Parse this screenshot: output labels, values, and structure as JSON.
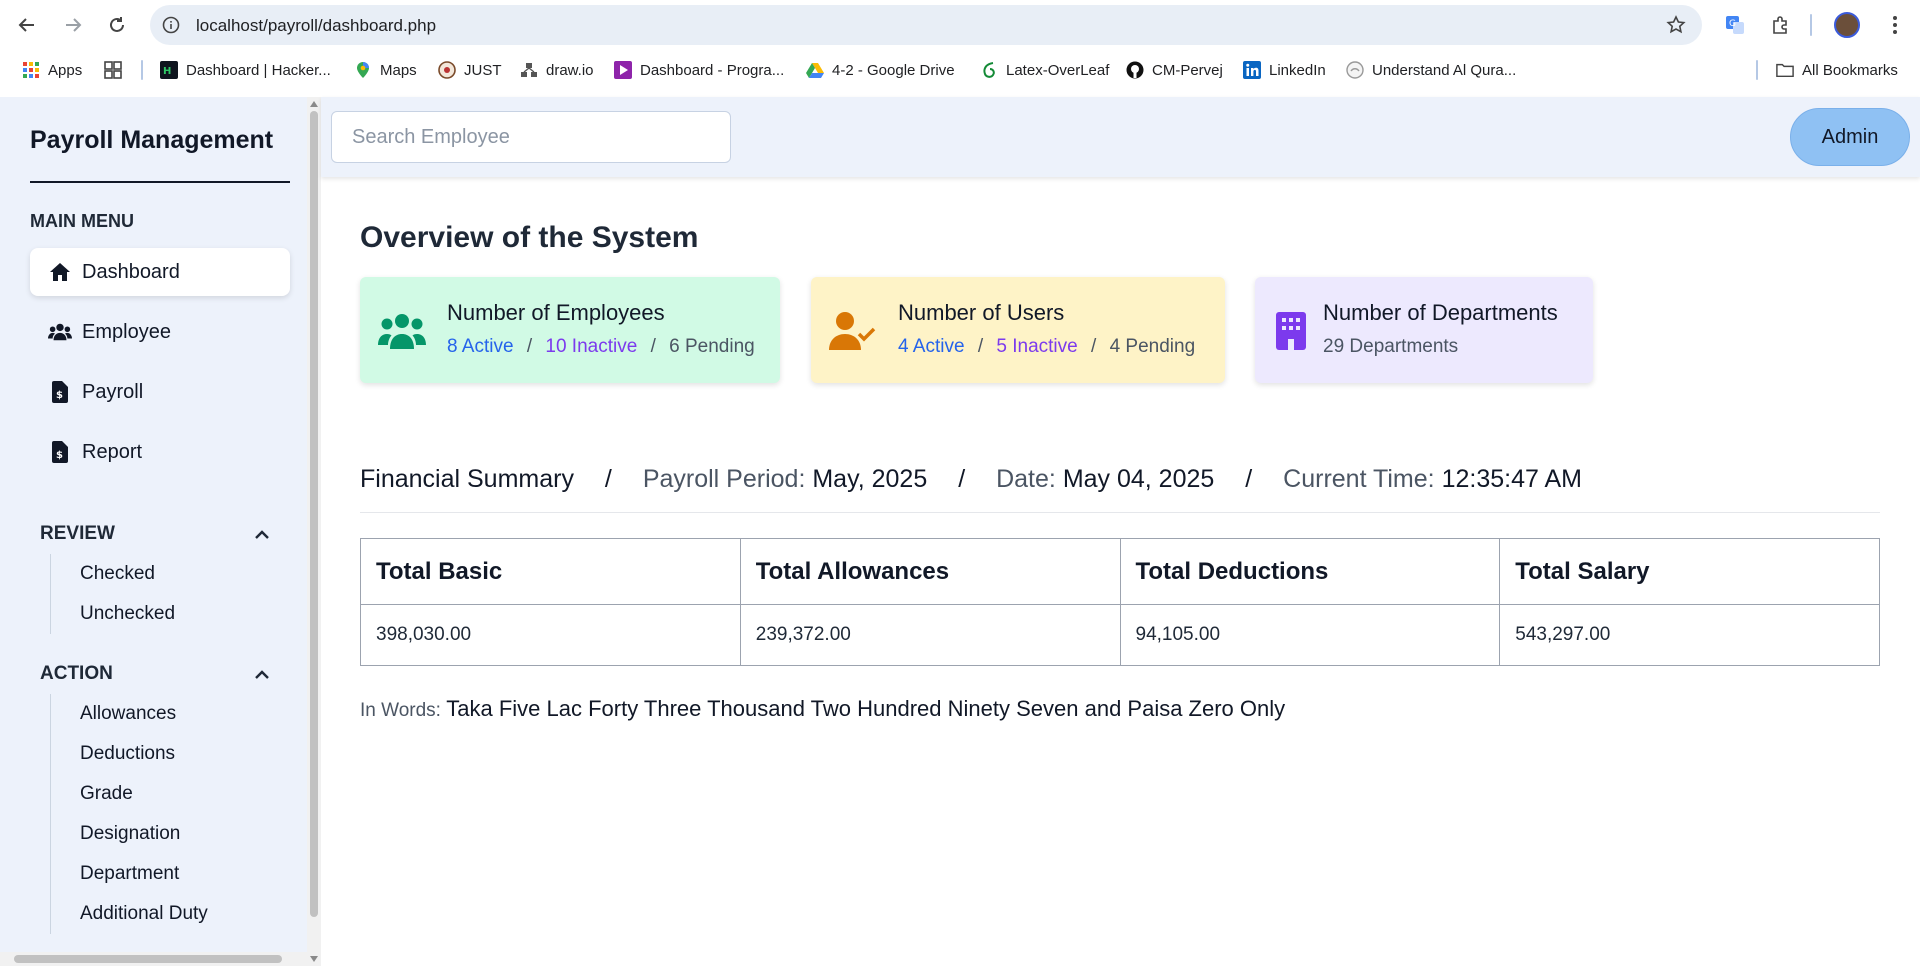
{
  "browser": {
    "url": "localhost/payroll/dashboard.php",
    "bookmarks": [
      {
        "label": "Apps",
        "icon": "apps-grid-icon"
      },
      {
        "label": "",
        "icon": "tab-groups-icon"
      },
      {
        "label": "Dashboard | Hacker...",
        "icon": "hackerrank-icon"
      },
      {
        "label": "Maps",
        "icon": "maps-pin-icon"
      },
      {
        "label": "JUST",
        "icon": "university-logo-icon"
      },
      {
        "label": "draw.io",
        "icon": "drawio-icon"
      },
      {
        "label": "Dashboard - Progra...",
        "icon": "programming-hero-icon"
      },
      {
        "label": "4-2 - Google Drive",
        "icon": "google-drive-icon"
      },
      {
        "label": "Latex-OverLeaf",
        "icon": "overleaf-icon"
      },
      {
        "label": "CM-Pervej",
        "icon": "github-icon"
      },
      {
        "label": "LinkedIn",
        "icon": "linkedin-icon"
      },
      {
        "label": "Understand Al Qura...",
        "icon": "quran-site-icon"
      }
    ],
    "all_bookmarks": "All Bookmarks"
  },
  "sidebar": {
    "brand": "Payroll Management",
    "main_menu_title": "MAIN MENU",
    "main_menu": [
      {
        "label": "Dashboard",
        "icon": "home-icon",
        "active": true
      },
      {
        "label": "Employee",
        "icon": "users-icon",
        "active": false
      },
      {
        "label": "Payroll",
        "icon": "invoice-dollar-icon",
        "active": false
      },
      {
        "label": "Report",
        "icon": "invoice-dollar-icon",
        "active": false
      }
    ],
    "review": {
      "title": "REVIEW",
      "items": [
        "Checked",
        "Unchecked"
      ]
    },
    "action": {
      "title": "ACTION",
      "items": [
        "Allowances",
        "Deductions",
        "Grade",
        "Designation",
        "Department",
        "Additional Duty"
      ]
    }
  },
  "topbar": {
    "search_placeholder": "Search Employee",
    "admin_label": "Admin"
  },
  "main": {
    "title": "Overview of the System",
    "cards": [
      {
        "title": "Number of Employees",
        "icon": "users-icon",
        "color": "#d1fae5",
        "icon_color": "#059669",
        "stats": {
          "active": "8 Active",
          "inactive": "10 Inactive",
          "pending": "6 Pending"
        }
      },
      {
        "title": "Number of Users",
        "icon": "user-check-icon",
        "color": "#fef3c7",
        "icon_color": "#d97706",
        "stats": {
          "active": "4 Active",
          "inactive": "5 Inactive",
          "pending": "4 Pending"
        }
      },
      {
        "title": "Number of Departments",
        "icon": "building-icon",
        "color": "#ede9fe",
        "icon_color": "#7c3aed",
        "stats": {
          "departments": "29 Departments"
        }
      }
    ],
    "financial": {
      "label": "Financial Summary",
      "period_label": "Payroll Period:",
      "period_value": "May, 2025",
      "date_label": "Date:",
      "date_value": "May 04, 2025",
      "time_label": "Current Time:",
      "time_value": "12:35:47 AM",
      "separator": "/"
    },
    "table": {
      "headers": [
        "Total Basic",
        "Total Allowances",
        "Total Deductions",
        "Total Salary"
      ],
      "values": [
        "398,030.00",
        "239,372.00",
        "94,105.00",
        "543,297.00"
      ]
    },
    "in_words_label": "In Words:",
    "in_words_value": "Taka Five Lac Forty Three Thousand Two Hundred Ninety Seven and Paisa Zero Only"
  }
}
